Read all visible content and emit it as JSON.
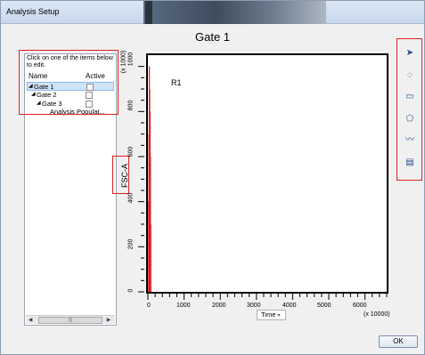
{
  "window": {
    "title": "Analysis Setup"
  },
  "heading": "Gate 1",
  "left_panel": {
    "hint": "Click on one of the items below to edit.",
    "columns": {
      "name": "Name",
      "active": "Active"
    },
    "rows": [
      {
        "label": "Gate 1",
        "selected": true
      },
      {
        "label": "Gate 2",
        "selected": false
      },
      {
        "label": "Gate 3",
        "selected": false
      }
    ],
    "analysis_label": "Analysis Populat..."
  },
  "plot": {
    "region_label": "R1",
    "y_unit": "(x 1000)",
    "y_title": "FSC-A",
    "x_title": "Time",
    "x_unit": "(x 10000)",
    "y_ticks": [
      "0",
      "200",
      "400",
      "600",
      "800",
      "1000"
    ],
    "x_ticks": [
      "0",
      "1000",
      "2000",
      "3000",
      "4000",
      "5000",
      "6000"
    ]
  },
  "chart_data": {
    "type": "scatter",
    "title": "Gate 1",
    "xlabel": "Time",
    "ylabel": "FSC-A",
    "xlim": [
      0,
      6600
    ],
    "ylim": [
      0,
      1050
    ],
    "annotations": [
      "R1"
    ],
    "series": [
      {
        "name": "R1",
        "color": "#e02020",
        "x": [
          0,
          20,
          30,
          40,
          50,
          60,
          70,
          80
        ],
        "y": [
          0,
          400,
          700,
          1000,
          900,
          800,
          600,
          300
        ]
      }
    ]
  },
  "toolbar": {
    "tools": [
      "pointer-icon",
      "ellipse-gate-icon",
      "rectangle-gate-icon",
      "polygon-gate-icon",
      "freehand-gate-icon",
      "histogram-gate-icon"
    ]
  },
  "buttons": {
    "ok": "OK"
  },
  "colors": {
    "highlight": "#e02020",
    "selection": "#cfe3fa"
  }
}
